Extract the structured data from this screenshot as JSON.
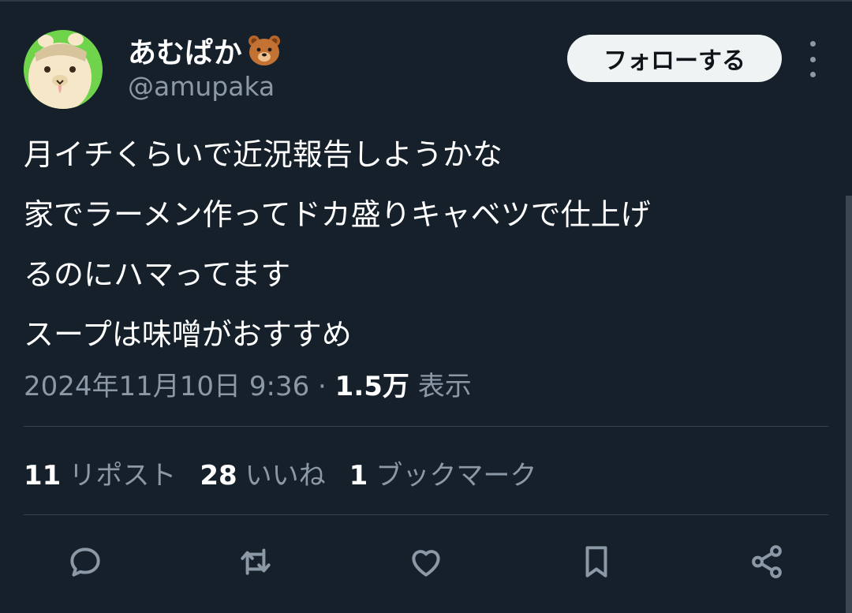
{
  "user": {
    "display_name": "あむぱか",
    "name_emoji": "bear-face-emoji",
    "handle": "@amupaka",
    "avatar_bg": "#6fd34c"
  },
  "follow_button_label": "フォローする",
  "tweet": {
    "lines": [
      "月イチくらいで近況報告しようかな",
      "家でラーメン作ってドカ盛りキャベツで仕上げ",
      "るのにハマってます",
      "スープは味噌がおすすめ"
    ],
    "timestamp": "2024年11月10日 9:36",
    "separator": "·",
    "views_count": "1.5万",
    "views_label": "表示"
  },
  "stats": [
    {
      "count": "11",
      "label": "リポスト"
    },
    {
      "count": "28",
      "label": "いいね"
    },
    {
      "count": "1",
      "label": "ブックマーク"
    }
  ],
  "actions": [
    "reply-icon",
    "retweet-icon",
    "like-icon",
    "bookmark-icon",
    "share-icon"
  ],
  "colors": {
    "background": "#15202b",
    "text": "#e7e9ea",
    "secondary": "#8b98a5",
    "button_bg": "#eff3f4"
  }
}
